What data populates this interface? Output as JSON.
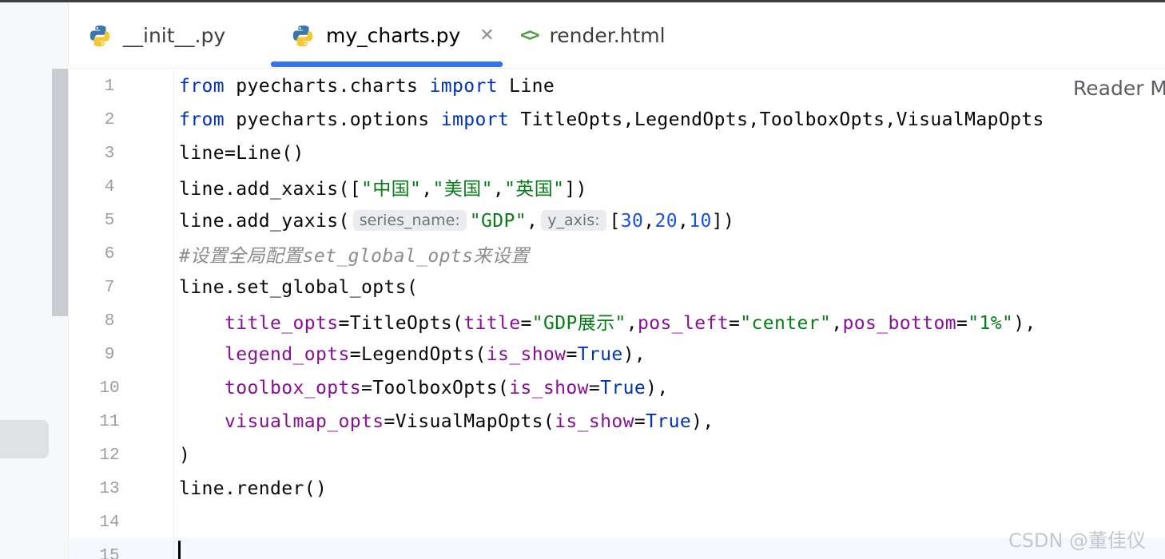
{
  "tabs": [
    {
      "label": "__init__.py",
      "icon": "python-icon"
    },
    {
      "label": "my_charts.py",
      "icon": "python-icon",
      "active": true
    },
    {
      "label": "render.html",
      "icon": "html-tag-icon"
    }
  ],
  "editor": {
    "reader_mode": "Reader M",
    "line_numbers": [
      "1",
      "2",
      "3",
      "4",
      "5",
      "6",
      "7",
      "8",
      "9",
      "10",
      "11",
      "12",
      "13",
      "14",
      "15"
    ],
    "inlay_hints": {
      "series_name": "series_name:",
      "y_axis": "y_axis:"
    }
  },
  "watermark": "CSDN @董佳仪",
  "colors": {
    "keyword": "#0033b3",
    "string": "#067d17",
    "number": "#1750eb",
    "parameter": "#871094",
    "comment": "#8c8c8c",
    "accent": "#3574f0"
  }
}
